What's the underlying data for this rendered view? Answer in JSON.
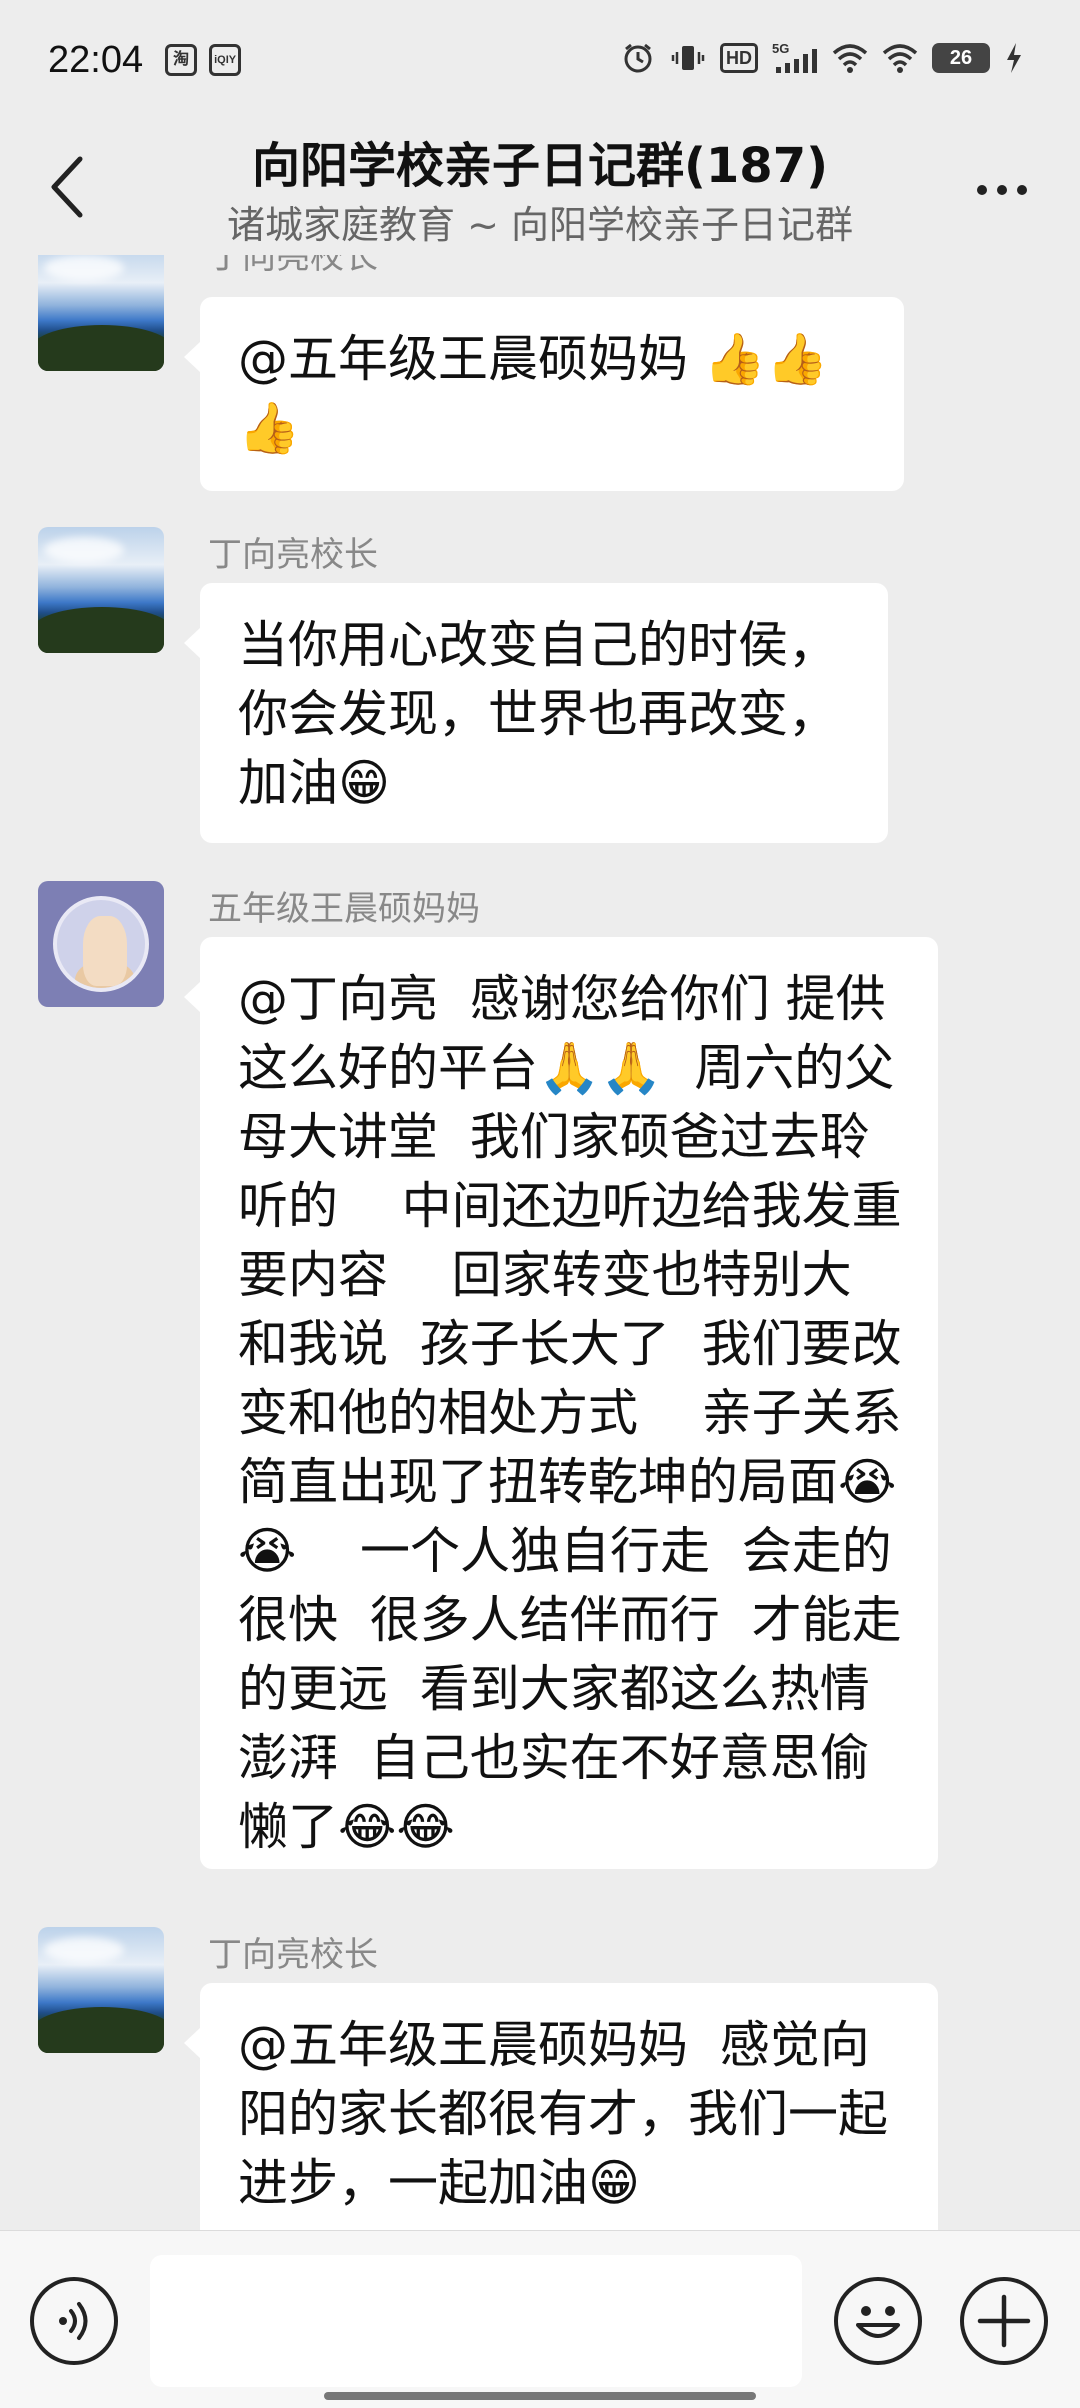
{
  "status": {
    "time": "22:04",
    "app_icons": [
      "淘",
      "iQIY"
    ],
    "battery": "26",
    "network": "5G",
    "hd": "HD"
  },
  "header": {
    "title": "向阳学校亲子日记群(187)",
    "subtitle": "诸城家庭教育 ~ 向阳学校亲子日记群"
  },
  "messages": [
    {
      "sender": "丁向亮校长",
      "text": "@五年级王晨硕妈妈 👍👍👍"
    },
    {
      "sender": "丁向亮校长",
      "text": "当你用心改变自己的时侯，你会发现，世界也再改变，加油😁"
    },
    {
      "sender": "五年级王晨硕妈妈",
      "text": "@丁向亮  感谢您给你们 提供这么好的平台🙏🙏  周六的父母大讲堂  我们家硕爸过去聆听的    中间还边听边给我发重要内容    回家转变也特别大  和我说  孩子长大了  我们要改变和他的相处方式    亲子关系简直出现了扭转乾坤的局面😭😭    一个人独自行走  会走的很快  很多人结伴而行  才能走的更远  看到大家都这么热情澎湃  自己也实在不好意思偷懒了😂😂"
    },
    {
      "sender": "丁向亮校长",
      "text": "@五年级王晨硕妈妈  感觉向阳的家长都很有才，我们一起进步，一起加油😁"
    }
  ],
  "input": {
    "placeholder": ""
  },
  "icons": {
    "back": "chevron-left-icon",
    "more": "more-dots-icon",
    "voice": "voice-icon",
    "emoji": "emoji-icon",
    "plus": "plus-icon"
  }
}
